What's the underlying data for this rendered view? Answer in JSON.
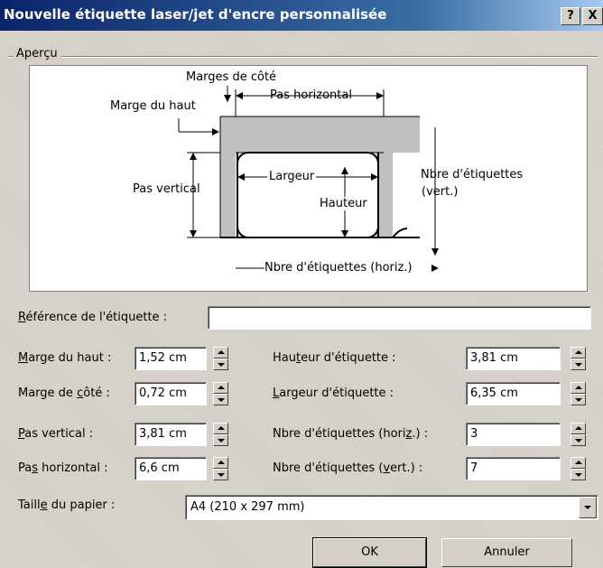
{
  "window": {
    "title": "Nouvelle étiquette laser/jet d'encre personnalisée",
    "help_label": "?",
    "close_label": "X"
  },
  "preview": {
    "group_label": "Aperçu",
    "labels": {
      "marges_de_cote": "Marges de côté",
      "pas_horizontal": "Pas horizontal",
      "marge_du_haut": "Marge du haut",
      "pas_vertical": "Pas vertical",
      "largeur": "Largeur",
      "hauteur": "Hauteur",
      "nbre_vert_line1": "Nbre d'étiquettes",
      "nbre_vert_line2": "(vert.)",
      "nbre_horiz": "Nbre d'étiquettes (horiz.)"
    }
  },
  "form": {
    "reference": {
      "label_u": "R",
      "label_rest": "éférence de l'étiquette :",
      "value": ""
    },
    "marge_haut": {
      "label_u": "M",
      "label_rest": "arge du haut :",
      "value": "1,52 cm"
    },
    "marge_cote": {
      "label_pre": "Marge de ",
      "label_u": "c",
      "label_rest": "ôté :",
      "value": "0,72 cm"
    },
    "pas_vertical": {
      "label_u": "P",
      "label_rest": "as vertical :",
      "value": "3,81 cm"
    },
    "pas_horizontal": {
      "label_pre": "Pa",
      "label_u": "s",
      "label_rest": " horizontal :",
      "value": "6,6 cm"
    },
    "hauteur": {
      "label_pre": "Hau",
      "label_u": "t",
      "label_rest": "eur d'étiquette :",
      "value": "3,81 cm"
    },
    "largeur": {
      "label_u": "L",
      "label_rest": "argeur d'étiquette :",
      "value": "6,35 cm"
    },
    "nbre_horiz": {
      "label_pre": "Nbre d'étiquettes (hori",
      "label_u": "z",
      "label_rest": ".) :",
      "value": "3"
    },
    "nbre_vert": {
      "label_pre": "Nbre d'étiquettes (",
      "label_u": "v",
      "label_rest": "ert.) :",
      "value": "7"
    },
    "taille_papier": {
      "label_pre": "Taill",
      "label_u": "e",
      "label_rest": " du papier :",
      "value": "A4 (210 x 297 mm)"
    }
  },
  "buttons": {
    "ok": "OK",
    "annuler": "Annuler"
  }
}
